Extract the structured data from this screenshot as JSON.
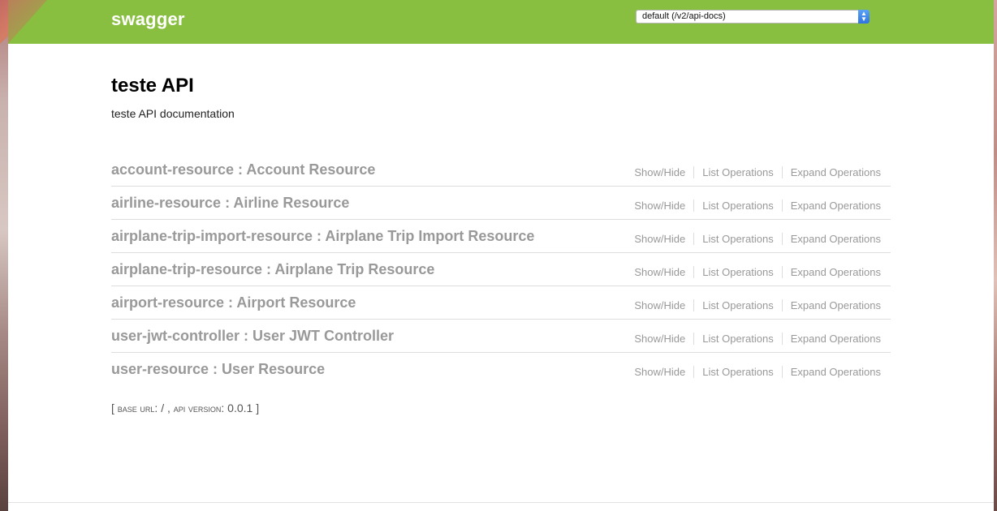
{
  "header": {
    "logo": "swagger",
    "spec_select_value": "default (/v2/api-docs)",
    "select_arrows": "▲▼",
    "brand_color": "#89bf40"
  },
  "info": {
    "title": "teste API",
    "description": "teste API documentation"
  },
  "operations_labels": {
    "show_hide": "Show/Hide",
    "list": "List Operations",
    "expand": "Expand Operations"
  },
  "resources": [
    {
      "name": "account-resource : Account Resource"
    },
    {
      "name": "airline-resource : Airline Resource"
    },
    {
      "name": "airplane-trip-import-resource : Airplane Trip Import Resource"
    },
    {
      "name": "airplane-trip-resource : Airplane Trip Resource"
    },
    {
      "name": "airport-resource : Airport Resource"
    },
    {
      "name": "user-jwt-controller : User JWT Controller"
    },
    {
      "name": "user-resource : User Resource"
    }
  ],
  "base": {
    "open_bracket": "[ ",
    "base_url_label": "base url",
    "base_url_value": ": / , ",
    "api_version_label": "api version",
    "api_version_value": ": 0.0.1",
    "close_bracket": " ]"
  }
}
